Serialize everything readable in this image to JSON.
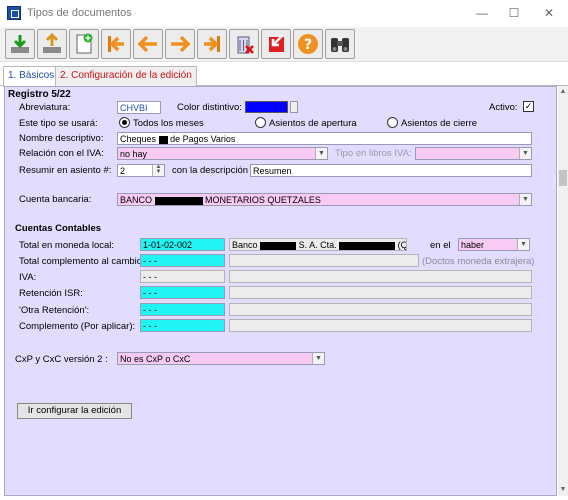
{
  "window": {
    "title": "Tipos de documentos",
    "controls": {
      "minimize": "—",
      "maximize": "☐",
      "close": "✕"
    }
  },
  "toolbar": {
    "buttons": [
      {
        "name": "download-button",
        "icon": "download-arrow-icon"
      },
      {
        "name": "upload-button",
        "icon": "upload-arrow-icon"
      },
      {
        "name": "new-document-button",
        "icon": "new-document-icon"
      },
      {
        "name": "first-record-button",
        "icon": "first-record-icon"
      },
      {
        "name": "previous-record-button",
        "icon": "arrow-left-icon"
      },
      {
        "name": "next-record-button",
        "icon": "arrow-right-icon"
      },
      {
        "name": "last-record-button",
        "icon": "last-record-icon"
      },
      {
        "name": "delete-button",
        "icon": "trash-icon"
      },
      {
        "name": "exit-button",
        "icon": "exit-icon"
      },
      {
        "name": "help-button",
        "icon": "help-icon"
      },
      {
        "name": "search-button",
        "icon": "binoculars-icon"
      }
    ]
  },
  "tabs": [
    {
      "label": "1. Básicos"
    },
    {
      "label": "2. Configuración de la edición"
    }
  ],
  "record": {
    "header": "Registro 5/22",
    "abbreviation_label": "Abreviatura:",
    "abbreviation_value": "CHVBI",
    "color_label": "Color distintivo:",
    "color_value": "#0000ff",
    "active_label": "Activo:",
    "active_checked": true,
    "usage_label": "Este tipo se usará:",
    "usage_options": [
      "Todos los meses",
      "Asientos de apertura",
      "Asientos de cierre"
    ],
    "usage_selected": "Todos los meses",
    "description_label": "Nombre descriptivo:",
    "description_value_pre": "Cheques",
    "description_value_post": "de Pagos Varios",
    "iva_relation_label": "Relación con el IVA:",
    "iva_relation_value": "no hay",
    "iva_book_label": "Tipo en libros IVA:",
    "iva_book_value": "",
    "summary_label": "Resumir en asiento #:",
    "summary_value": "2",
    "summary_desc_label": "con la descripción",
    "summary_desc_value": "Resumen",
    "bank_label": "Cuenta bancaria:",
    "bank_value_pre": "BANCO",
    "bank_value_post": "MONETARIOS QUETZALES"
  },
  "accounts": {
    "header": "Cuentas Contables",
    "rows": [
      {
        "label": "Total en moneda local:",
        "code": "1-01-02-002"
      },
      {
        "label": "Total complemento al cambio:",
        "code": "- - -"
      },
      {
        "label": "IVA:",
        "code": "- - -"
      },
      {
        "label": "Retención ISR:",
        "code": "- - -"
      },
      {
        "label": "'Otra Retención':",
        "code": "- - -"
      },
      {
        "label": "Complemento (Por aplicar):",
        "code": "- - -"
      }
    ],
    "bank_desc_pre": "Banco",
    "bank_desc_mid": "S. A. Cta.",
    "bank_desc_post": "(Q)",
    "side_label": "en el",
    "side_value": "haber",
    "foreign_note": "(Doctos moneda extrajera)"
  },
  "cxp": {
    "label": "CxP y CxC versión 2 :",
    "value": "No es CxP o CxC"
  },
  "actions": {
    "configure_label": "Ir configurar la edición"
  }
}
